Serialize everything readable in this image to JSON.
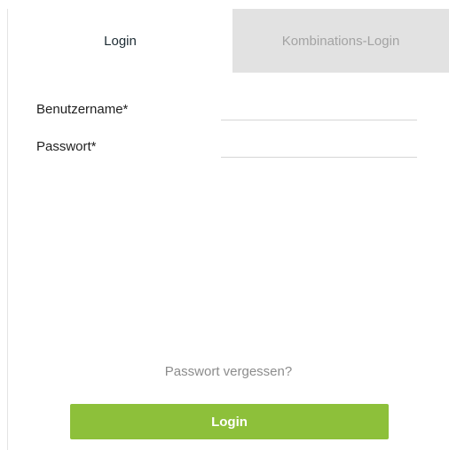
{
  "tabs": [
    {
      "label": "Login",
      "active": true
    },
    {
      "label": "Kombinations-Login",
      "active": false
    }
  ],
  "form": {
    "username_label": "Benutzername*",
    "username_value": "",
    "password_label": "Passwort*",
    "password_value": ""
  },
  "forgot_password_label": "Passwort vergessen?",
  "login_button_label": "Login",
  "colors": {
    "accent": "#8dc03a",
    "inactive_tab": "#e2e2e2",
    "muted_text": "#8c8c8c"
  }
}
